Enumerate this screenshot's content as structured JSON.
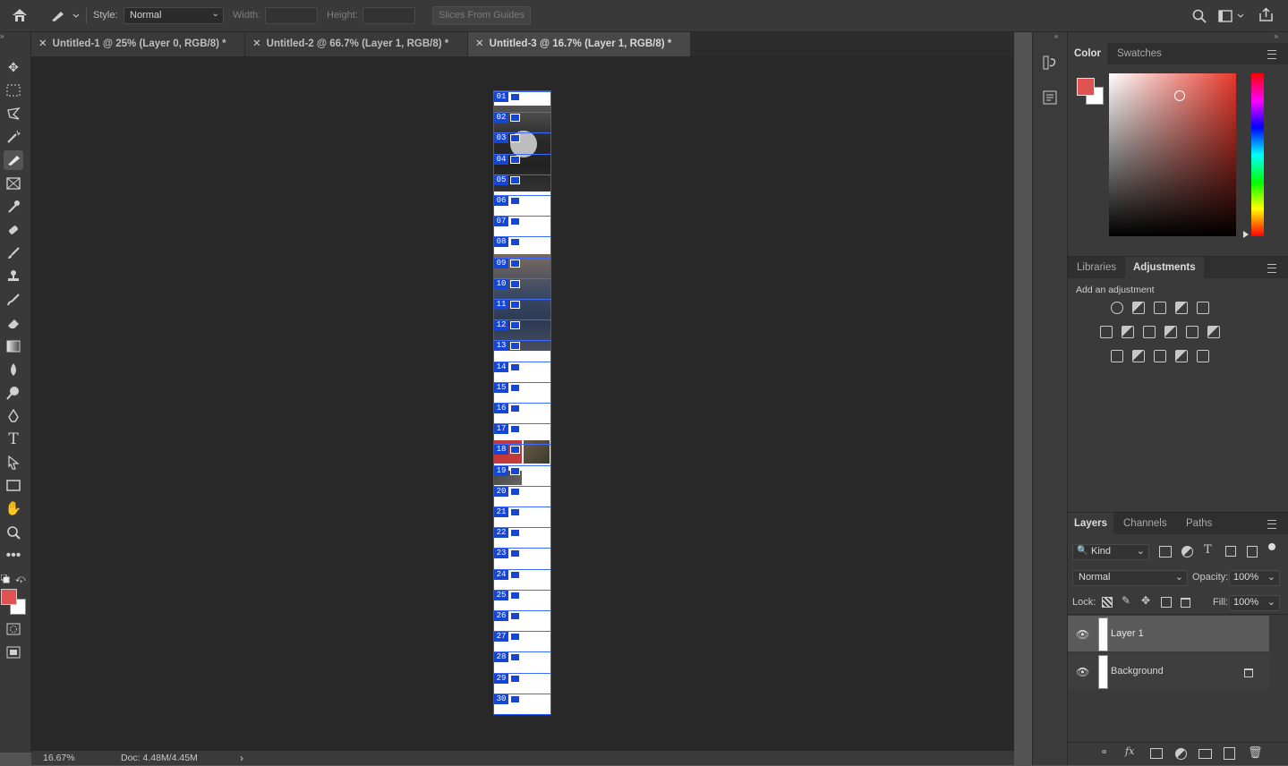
{
  "options_bar": {
    "style_label": "Style:",
    "style_value": "Normal",
    "width_label": "Width:",
    "width_value": "",
    "height_label": "Height:",
    "height_value": "",
    "slices_button": "Slices From Guides"
  },
  "tabs": [
    {
      "label": "Untitled-1 @ 25% (Layer 0, RGB/8) *",
      "active": false
    },
    {
      "label": "Untitled-2 @ 66.7% (Layer 1, RGB/8) *",
      "active": false
    },
    {
      "label": "Untitled-3 @ 16.7% (Layer 1, RGB/8) *",
      "active": true
    }
  ],
  "slices": [
    "01",
    "02",
    "03",
    "04",
    "05",
    "06",
    "07",
    "08",
    "09",
    "10",
    "11",
    "12",
    "13",
    "14",
    "15",
    "16",
    "17",
    "18",
    "19",
    "20",
    "21",
    "22",
    "23",
    "24",
    "25",
    "26",
    "27",
    "28",
    "29",
    "30"
  ],
  "status": {
    "zoom": "16.67%",
    "doc": "Doc: 4.48M/4.45M",
    "arrow": "›"
  },
  "color_panel": {
    "tab_color": "Color",
    "tab_swatches": "Swatches",
    "foreground": "#e05252",
    "background": "#ffffff"
  },
  "adjustments_panel": {
    "tab_libraries": "Libraries",
    "tab_adjustments": "Adjustments",
    "hint": "Add an adjustment"
  },
  "layers_panel": {
    "tab_layers": "Layers",
    "tab_channels": "Channels",
    "tab_paths": "Paths",
    "filter_kind": "Kind",
    "blend_mode": "Normal",
    "opacity_label": "Opacity:",
    "opacity_value": "100%",
    "lock_label": "Lock:",
    "fill_label": "Fill:",
    "fill_value": "100%",
    "layers": [
      {
        "name": "Layer 1",
        "selected": true
      },
      {
        "name": "Background",
        "selected": false
      }
    ]
  }
}
